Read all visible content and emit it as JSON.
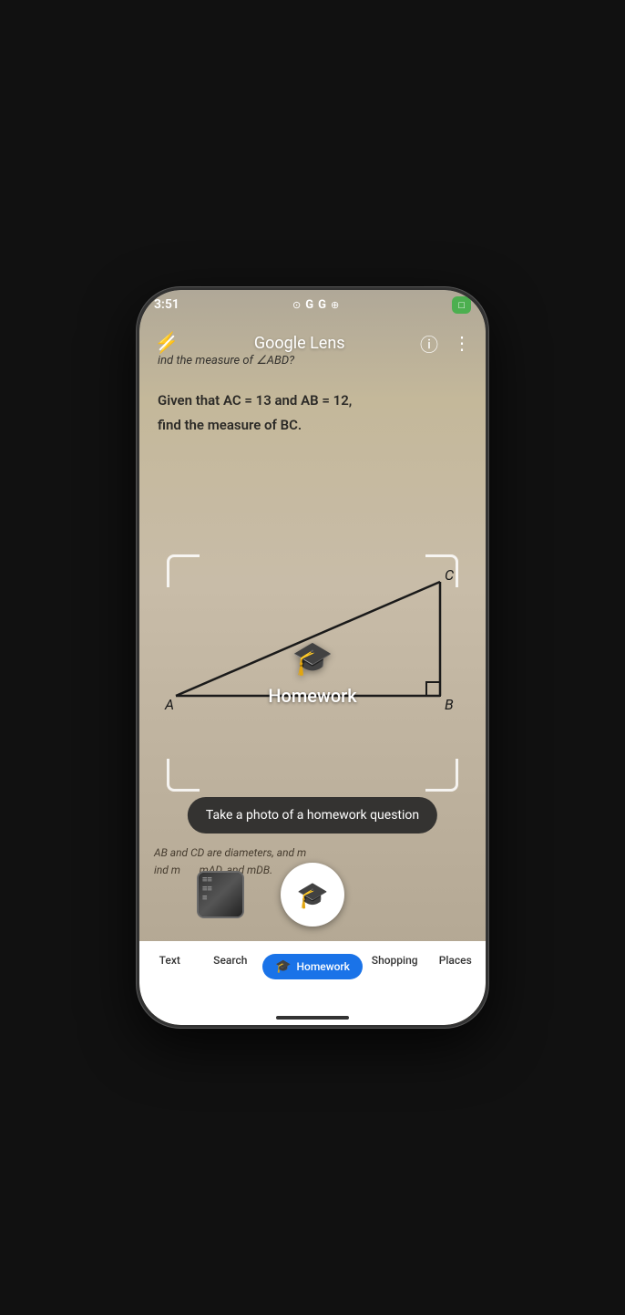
{
  "statusBar": {
    "time": "3:51",
    "icons": [
      "●",
      "G",
      "G",
      "⊕"
    ],
    "batteryLabel": "□"
  },
  "toolbar": {
    "title": "Google Lens",
    "googlePart": "Google",
    "lensPart": "Lens",
    "flashIcon": "⚡",
    "infoIcon": "ⓘ",
    "moreIcon": "⋮"
  },
  "cameraView": {
    "mathLine1": "ind the measure of ∠ABD?",
    "mathLine2": "Given that AC = 13 and AB = 12,",
    "mathLine3": "find the measure of BC.",
    "triangleLabel": "Homework",
    "triangleIcon": "🎓",
    "vertexA": "A",
    "vertexB": "B",
    "vertexC": "C"
  },
  "scanFrame": {
    "centerIcon": "🎓",
    "centerLabel": "Homework"
  },
  "hintBubble": {
    "text": "Take a photo of a homework question"
  },
  "shutterArea": {
    "shutterIcon": "🎓"
  },
  "bottomMathText": {
    "line1": "AB and CD are diameters, and m",
    "line2": "ind m",
    "line3": "mAD, and mDB."
  },
  "tabs": [
    {
      "id": "translate",
      "label": ""
    },
    {
      "id": "text",
      "label": "Text"
    },
    {
      "id": "search",
      "label": "Search"
    },
    {
      "id": "homework",
      "label": "Homework",
      "active": true
    },
    {
      "id": "shopping",
      "label": "Shopping"
    },
    {
      "id": "places",
      "label": "Places"
    }
  ]
}
